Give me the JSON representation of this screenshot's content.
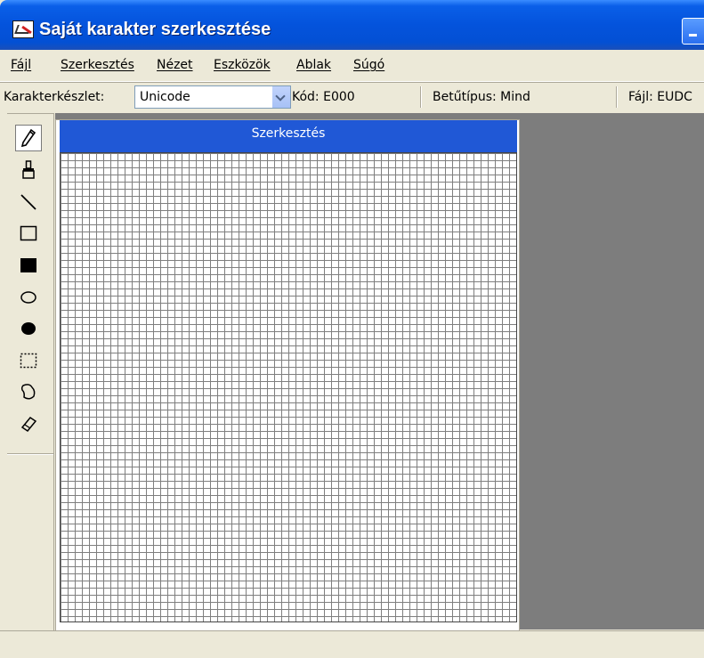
{
  "window": {
    "title": "Saját karakter szerkesztése"
  },
  "menu": {
    "items": [
      {
        "label": "Fájl"
      },
      {
        "label": "Szerkesztés"
      },
      {
        "label": "Nézet"
      },
      {
        "label": "Eszközök"
      },
      {
        "label": "Ablak"
      },
      {
        "label": "Súgó"
      }
    ]
  },
  "status": {
    "charset_label": "Karakterkészlet:",
    "charset_value": "Unicode",
    "code": "Kód: E000",
    "font": "Betűtípus: Mind",
    "file": "Fájl: EUDC"
  },
  "tools": [
    {
      "icon": "pencil-icon",
      "active": true
    },
    {
      "icon": "brush-icon"
    },
    {
      "icon": "line-icon"
    },
    {
      "icon": "hollow-rectangle-icon"
    },
    {
      "icon": "filled-rectangle-icon"
    },
    {
      "icon": "hollow-ellipse-icon"
    },
    {
      "icon": "filled-ellipse-icon"
    },
    {
      "icon": "rectangular-selection-icon"
    },
    {
      "icon": "freeform-selection-icon"
    },
    {
      "icon": "eraser-icon"
    }
  ],
  "editor": {
    "title": "Szerkesztés"
  },
  "colors": {
    "titlebar": "#0453DC",
    "editor_title": "#2058D6",
    "workspace": "#7D7D7D",
    "chrome": "#ECE9D8"
  }
}
